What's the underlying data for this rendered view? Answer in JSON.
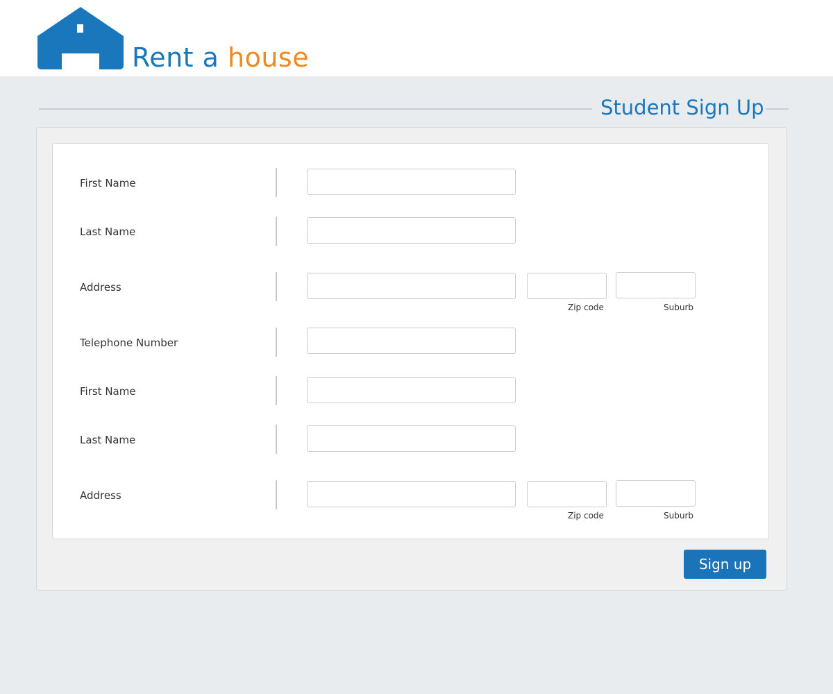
{
  "brand": {
    "word1": "Rent a ",
    "word2": "house"
  },
  "page_title": "Student Sign Up",
  "colors": {
    "brand_blue": "#1b77bc",
    "brand_orange": "#ef8a1f",
    "button_blue": "#1b73ba",
    "background": "#e9ecef"
  },
  "icons": {
    "logo": "house-icon"
  },
  "form": {
    "rows": [
      {
        "label": "First Name",
        "value": ""
      },
      {
        "label": "Last Name",
        "value": ""
      },
      {
        "label": "Address",
        "value": "",
        "zip_label": "Zip code",
        "zip_value": "",
        "suburb_label": "Suburb",
        "suburb_value": ""
      },
      {
        "label": "Telephone Number",
        "value": ""
      },
      {
        "label": "First Name",
        "value": ""
      },
      {
        "label": "Last Name",
        "value": ""
      },
      {
        "label": "Address",
        "value": "",
        "zip_label": "Zip code",
        "zip_value": "",
        "suburb_label": "Suburb",
        "suburb_value": ""
      }
    ]
  },
  "signup_label": "Sign up"
}
